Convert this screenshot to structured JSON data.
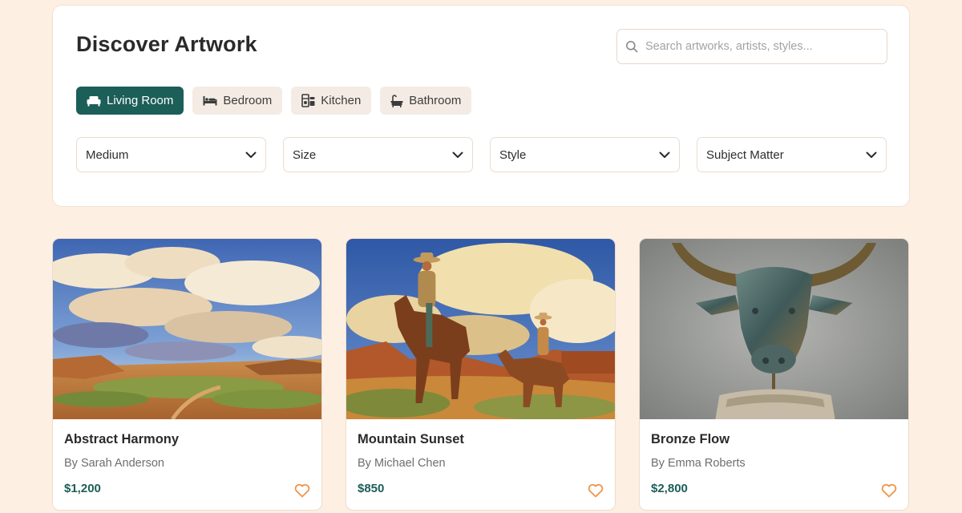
{
  "header": {
    "title": "Discover Artwork",
    "search_placeholder": "Search artworks, artists, styles..."
  },
  "room_tabs": [
    {
      "label": "Living Room",
      "icon": "sofa-icon",
      "active": true
    },
    {
      "label": "Bedroom",
      "icon": "bed-icon",
      "active": false
    },
    {
      "label": "Kitchen",
      "icon": "kitchen-icon",
      "active": false
    },
    {
      "label": "Bathroom",
      "icon": "bathtub-icon",
      "active": false
    }
  ],
  "filters": [
    {
      "label": "Medium",
      "icon": "chevron-down-icon"
    },
    {
      "label": "Size",
      "icon": "chevron-down-icon"
    },
    {
      "label": "Style",
      "icon": "chevron-down-icon"
    },
    {
      "label": "Subject Matter",
      "icon": "chevron-down-icon"
    }
  ],
  "artworks": [
    {
      "title": "Abstract Harmony",
      "artist": "By Sarah Anderson",
      "price": "$1,200",
      "icon": "heart-icon"
    },
    {
      "title": "Mountain Sunset",
      "artist": "By Michael Chen",
      "price": "$850",
      "icon": "heart-icon"
    },
    {
      "title": "Bronze Flow",
      "artist": "By Emma Roberts",
      "price": "$2,800",
      "icon": "heart-icon"
    }
  ],
  "colors": {
    "background": "#fdf0e3",
    "accent": "#1c5e58",
    "heart": "#f0964a",
    "tab_inactive": "#f4ece4"
  }
}
